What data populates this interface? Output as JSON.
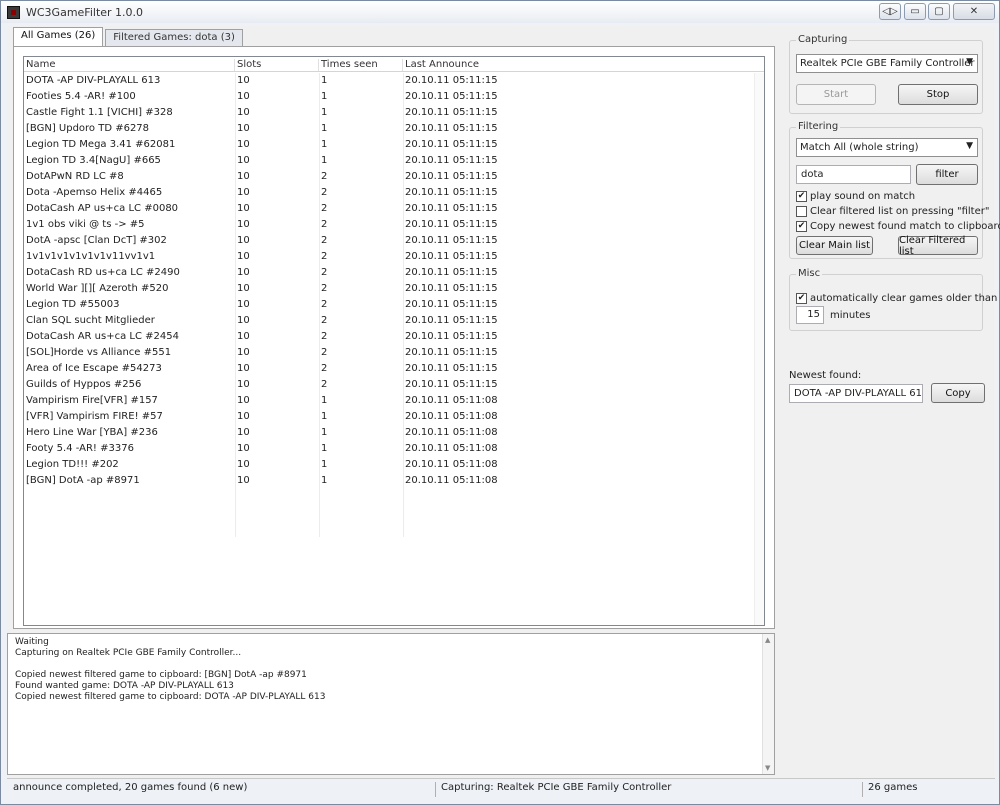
{
  "window": {
    "title": "WC3GameFilter 1.0.0",
    "buttons": {
      "extra": "◁▷",
      "minimize": "▭",
      "maximize": "▢",
      "close": "✕"
    }
  },
  "tabs": [
    {
      "label": "All Games (26)"
    },
    {
      "label": "Filtered Games: dota (3)"
    }
  ],
  "games": {
    "columns": [
      "Name",
      "Slots",
      "Times seen",
      "Last Announce"
    ],
    "rows": [
      [
        "DOTA -AP DIV-PLAYALL 613",
        "10",
        "1",
        "20.10.11 05:11:15"
      ],
      [
        "Footies 5.4 -AR! #100",
        "10",
        "1",
        "20.10.11 05:11:15"
      ],
      [
        "Castle Fight 1.1 [VICHI] #328",
        "10",
        "1",
        "20.10.11 05:11:15"
      ],
      [
        "[BGN] Updoro TD #6278",
        "10",
        "1",
        "20.10.11 05:11:15"
      ],
      [
        "Legion TD Mega 3.41 #62081",
        "10",
        "1",
        "20.10.11 05:11:15"
      ],
      [
        "Legion TD 3.4[NagU] #665",
        "10",
        "1",
        "20.10.11 05:11:15"
      ],
      [
        "DotAPwN RD LC #8",
        "10",
        "2",
        "20.10.11 05:11:15"
      ],
      [
        "Dota -Apemso Helix #4465",
        "10",
        "2",
        "20.10.11 05:11:15"
      ],
      [
        "DotaCash AP us+ca LC #0080",
        "10",
        "2",
        "20.10.11 05:11:15"
      ],
      [
        "1v1 obs viki @ ts -> #5",
        "10",
        "2",
        "20.10.11 05:11:15"
      ],
      [
        "DotA -apsc [Clan DcT] #302",
        "10",
        "2",
        "20.10.11 05:11:15"
      ],
      [
        "1v1v1v1v1v1v1v11vv1v1",
        "10",
        "2",
        "20.10.11 05:11:15"
      ],
      [
        "DotaCash RD us+ca LC #2490",
        "10",
        "2",
        "20.10.11 05:11:15"
      ],
      [
        "World War ][][ Azeroth #520",
        "10",
        "2",
        "20.10.11 05:11:15"
      ],
      [
        "Legion TD #55003",
        "10",
        "2",
        "20.10.11 05:11:15"
      ],
      [
        "Clan SQL sucht Mitglieder",
        "10",
        "2",
        "20.10.11 05:11:15"
      ],
      [
        "DotaCash AR us+ca LC #2454",
        "10",
        "2",
        "20.10.11 05:11:15"
      ],
      [
        "[SOL]Horde vs Alliance #551",
        "10",
        "2",
        "20.10.11 05:11:15"
      ],
      [
        "Area of Ice Escape #54273",
        "10",
        "2",
        "20.10.11 05:11:15"
      ],
      [
        "Guilds of Hyppos #256",
        "10",
        "2",
        "20.10.11 05:11:15"
      ],
      [
        "Vampirism Fire[VFR] #157",
        "10",
        "1",
        "20.10.11 05:11:08"
      ],
      [
        "[VFR] Vampirism FIRE! #57",
        "10",
        "1",
        "20.10.11 05:11:08"
      ],
      [
        "Hero Line War [YBA] #236",
        "10",
        "1",
        "20.10.11 05:11:08"
      ],
      [
        "Footy 5.4 -AR! #3376",
        "10",
        "1",
        "20.10.11 05:11:08"
      ],
      [
        "Legion TD!!! #202",
        "10",
        "1",
        "20.10.11 05:11:08"
      ],
      [
        "[BGN] DotA -ap #8971",
        "10",
        "1",
        "20.10.11 05:11:08"
      ]
    ]
  },
  "log": [
    "Waiting",
    "Capturing on Realtek PCIe GBE Family Controller...",
    "",
    "Copied newest filtered game to cipboard: [BGN] DotA -ap #8971",
    "Found wanted game: DOTA -AP DIV-PLAYALL 613",
    "Copied newest filtered game to cipboard: DOTA -AP DIV-PLAYALL 613"
  ],
  "status": {
    "left": "announce completed, 20 games found (6 new)",
    "middle": "Capturing: Realtek PCIe GBE Family Controller",
    "right": "26 games"
  },
  "capturing": {
    "title": "Capturing",
    "device": "Realtek PCIe GBE Family Controller",
    "start_label": "Start",
    "stop_label": "Stop"
  },
  "filtering": {
    "title": "Filtering",
    "mode": "Match All (whole string)",
    "filter_text": "dota",
    "filter_button": "filter",
    "options": [
      {
        "label": "play sound on match",
        "checked": "✔"
      },
      {
        "label": "Clear filtered list on pressing \"filter\"",
        "checked": ""
      },
      {
        "label": "Copy newest found match to clipboard",
        "checked": "✔"
      }
    ],
    "clear_main_label": "Clear Main list",
    "clear_filtered_label": "Clear Filtered list"
  },
  "misc": {
    "title": "Misc",
    "auto_clear_label": "automatically clear games older than",
    "auto_clear_checked": "✔",
    "minutes_value": "15",
    "minutes_label": "minutes"
  },
  "newest": {
    "label": "Newest found:",
    "value": "DOTA -AP DIV-PLAYALL 613",
    "copy_label": "Copy"
  }
}
